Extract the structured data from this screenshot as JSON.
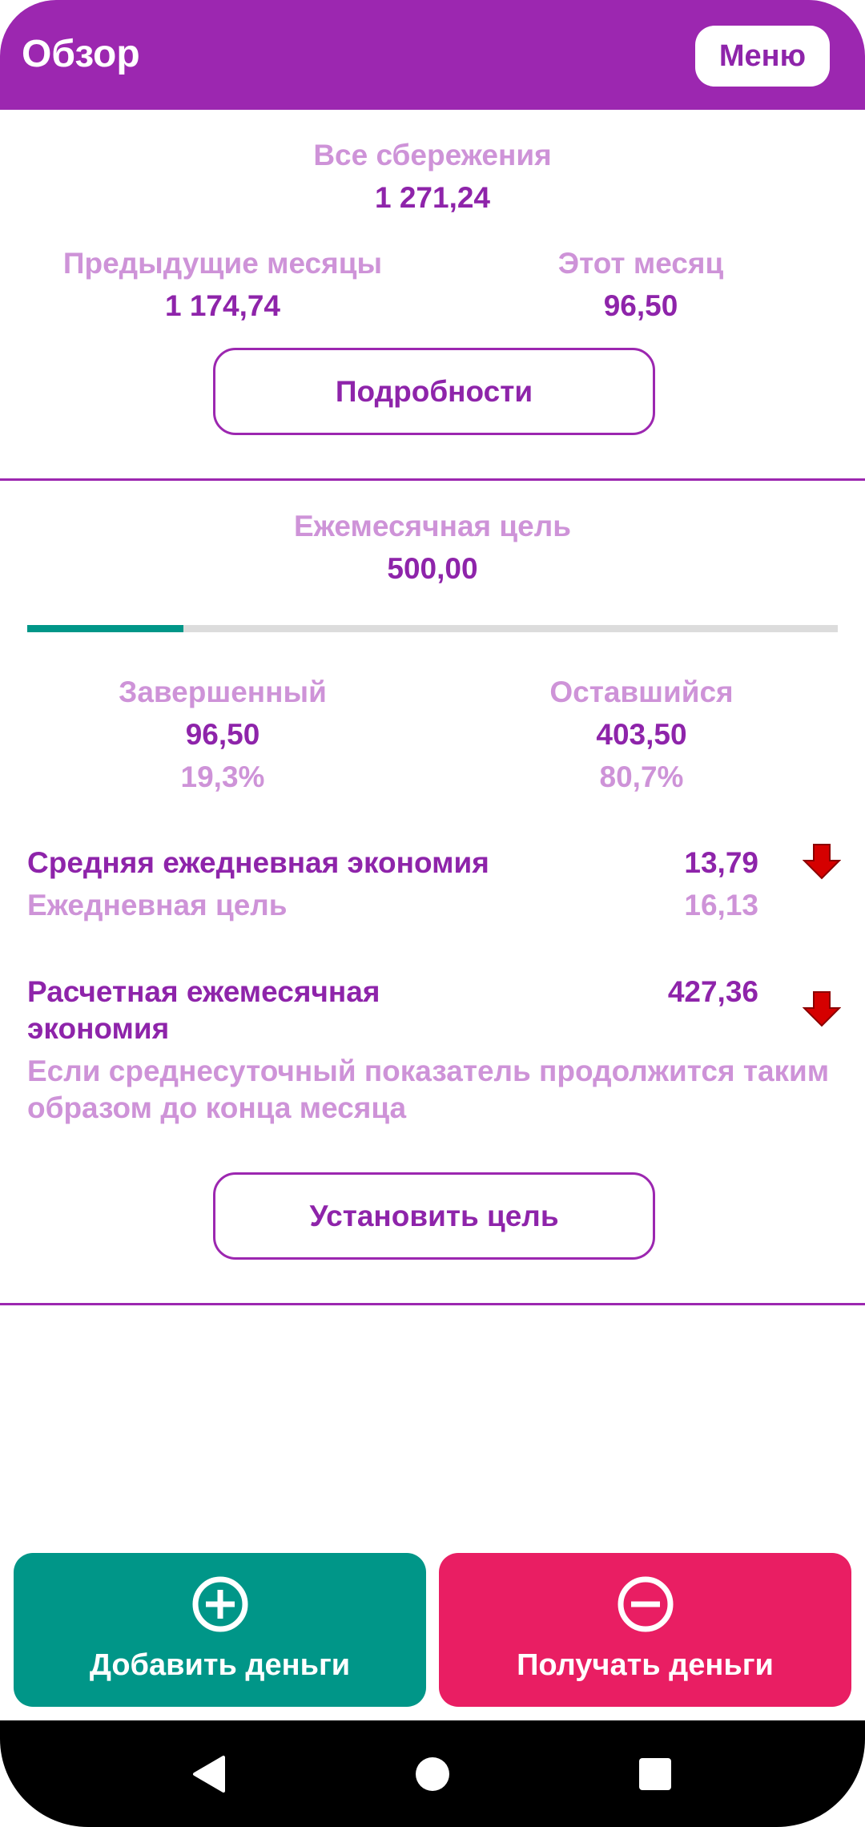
{
  "header": {
    "title": "Обзор",
    "menu_label": "Меню"
  },
  "savings": {
    "total_label": "Все сбережения",
    "total_value": "1 271,24",
    "previous_label": "Предыдущие месяцы",
    "previous_value": "1 174,74",
    "this_month_label": "Этот месяц",
    "this_month_value": "96,50",
    "details_button": "Подробности"
  },
  "goal": {
    "label": "Ежемесячная цель",
    "value": "500,00",
    "progress_fraction": 0.193,
    "completed_label": "Завершенный",
    "completed_value": "96,50",
    "completed_percent": "19,3%",
    "remaining_label": "Оставшийся",
    "remaining_value": "403,50",
    "remaining_percent": "80,7%"
  },
  "daily": {
    "average_label": "Средняя ежедневная экономия",
    "average_value": "13,79",
    "goal_label": "Ежедневная цель",
    "goal_value": "16,13",
    "trend_icon": "arrow-down-icon"
  },
  "projection": {
    "label_line1": "Расчетная ежемесячная",
    "label_line2": "экономия",
    "value": "427,36",
    "note_line1": "Если среднесуточный показатель продолжится таким",
    "note_line2": "образом до конца месяца",
    "trend_icon": "arrow-down-icon",
    "set_goal_button": "Установить цель"
  },
  "actions": {
    "add_label": "Добавить деньги",
    "add_icon": "plus-circle-icon",
    "withdraw_label": "Получать деньги",
    "withdraw_icon": "minus-circle-icon"
  },
  "colors": {
    "primary": "#9c27b0",
    "primary_text": "#8e24aa",
    "light_text": "#ce93d8",
    "progress": "#009688",
    "add": "#009688",
    "withdraw": "#e91e63",
    "trend_down": "#d50000"
  },
  "navbar": {
    "icons": [
      "back-icon",
      "home-icon",
      "recents-icon"
    ]
  }
}
